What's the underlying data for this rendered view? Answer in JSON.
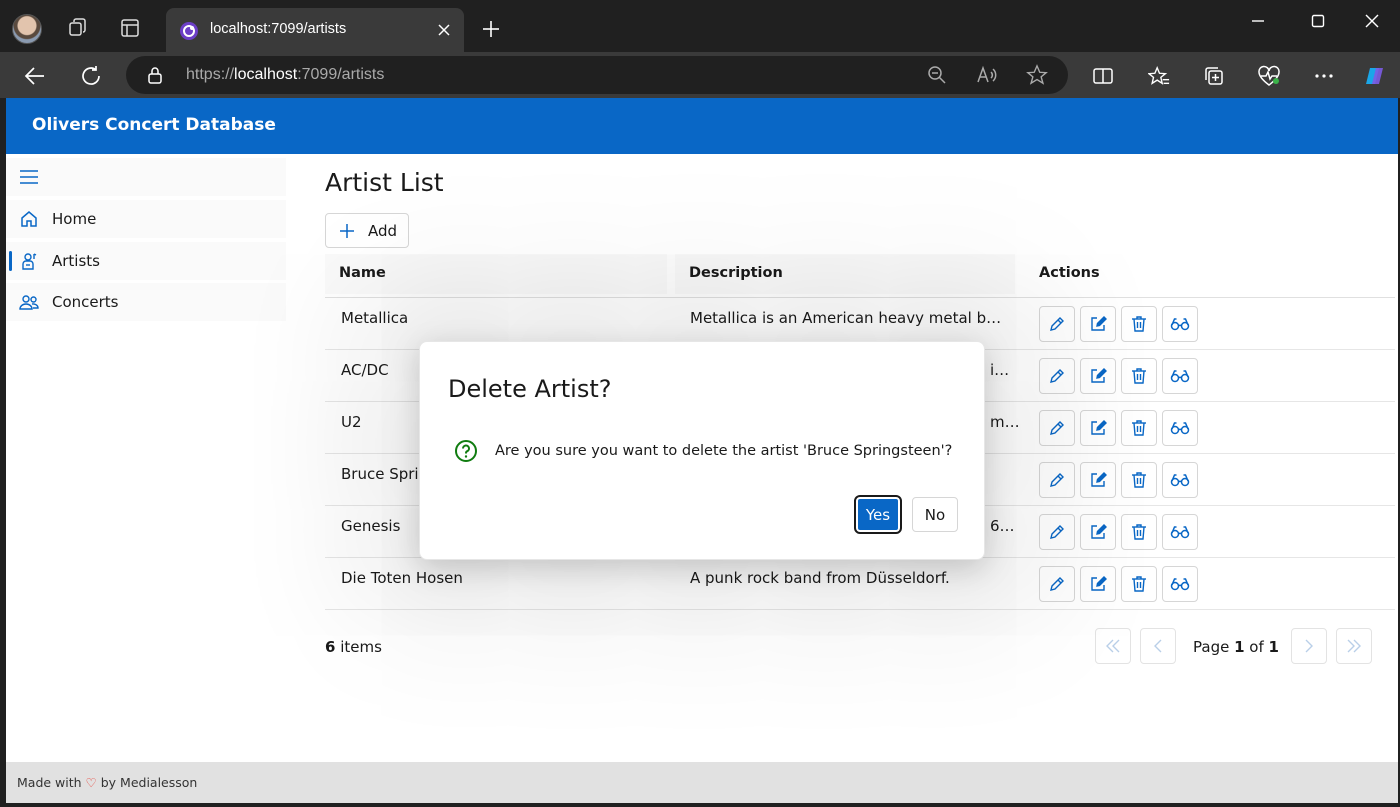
{
  "browser": {
    "tab_title": "localhost:7099/artists",
    "url_scheme": "https://",
    "url_host": "localhost",
    "url_rest": ":7099/artists"
  },
  "app": {
    "title": "Olivers Concert Database"
  },
  "nav": {
    "items": [
      {
        "label": "Home",
        "icon": "home-icon"
      },
      {
        "label": "Artists",
        "icon": "artist-icon",
        "active": true
      },
      {
        "label": "Concerts",
        "icon": "people-icon"
      }
    ]
  },
  "main": {
    "title": "Artist List",
    "add_label": "Add",
    "columns": [
      "Name",
      "Description",
      "Actions"
    ],
    "rows": [
      {
        "name": "Metallica",
        "description": "Metallica is an American heavy metal band. …"
      },
      {
        "name": "AC/DC",
        "description": "i…"
      },
      {
        "name": "U2",
        "description": "m…"
      },
      {
        "name": "Bruce Sprin",
        "description": ""
      },
      {
        "name": "Genesis",
        "description": "6…"
      },
      {
        "name": "Die Toten Hosen",
        "description": "A punk rock band from Düsseldorf."
      }
    ],
    "item_count": "6",
    "item_count_suffix": " items",
    "pager": {
      "page_word": "Page ",
      "current": "1",
      "of_word": " of ",
      "total": "1"
    }
  },
  "footer": {
    "made_with": "Made with ",
    "heart": "♡",
    "by": " by Medialesson"
  },
  "dialog": {
    "title": "Delete Artist?",
    "message": "Are you sure you want to delete the artist 'Bruce Springsteen'?",
    "yes_label": "Yes",
    "no_label": "No"
  },
  "colors": {
    "accent": "#0967c6",
    "chrome_dark": "#202020",
    "chrome_toolbar": "#3a3a3a",
    "success_icon": "#107c10"
  }
}
